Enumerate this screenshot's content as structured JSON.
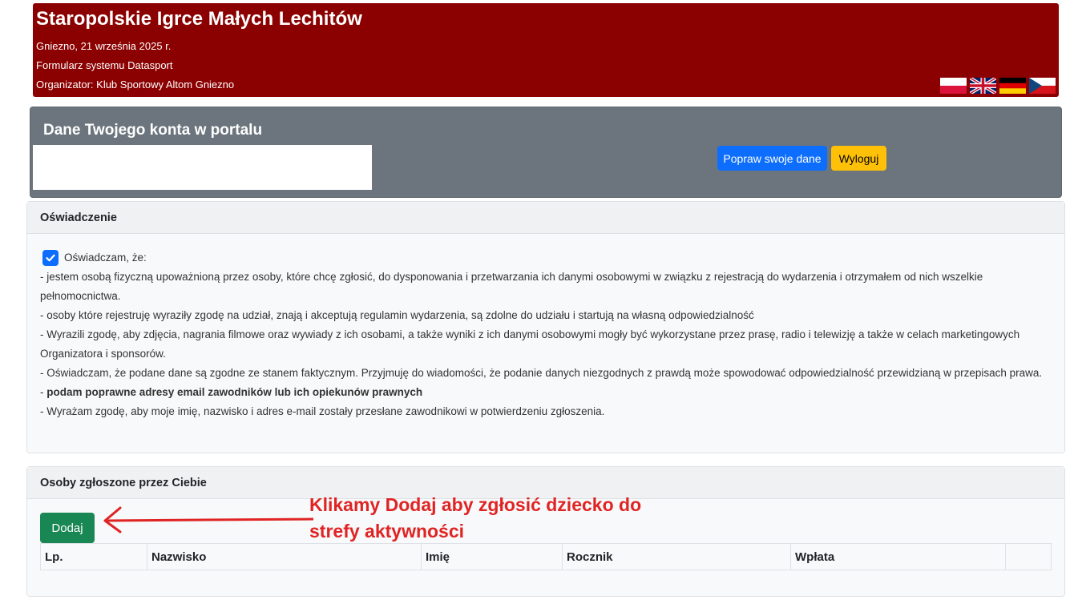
{
  "header": {
    "title": "Staropolskie Igrce Małych Lechitów",
    "date": "Gniezno, 21 września 2025 r.",
    "system": "Formularz systemu Datasport",
    "organizer": "Organizator: Klub Sportowy Altom Gniezno",
    "flags": [
      "flag-pl-icon",
      "flag-uk-icon",
      "flag-de-icon",
      "flag-cz-icon"
    ]
  },
  "account": {
    "title": "Dane Twojego konta w portalu",
    "edit_button": "Popraw swoje dane",
    "logout_button": "Wyloguj"
  },
  "declaration": {
    "header": "Oświadczenie",
    "checked": true,
    "intro": "Oświadczam, że:",
    "line1": "- jestem osobą fizyczną upoważnioną przez osoby, które chcę zgłosić, do dysponowania i przetwarzania ich danymi osobowymi w związku z rejestracją do wydarzenia i otrzymałem od nich wszelkie pełnomocnictwa.",
    "line2": "- osoby które rejestruję wyraziły zgodę na udział, znają i akceptują regulamin wydarzenia, są zdolne do udziału i startują na własną odpowiedzialność",
    "line3": "- Wyrazili zgodę, aby zdjęcia, nagrania filmowe oraz wywiady z ich osobami, a także wyniki z ich danymi osobowymi mogły być wykorzystane przez prasę, radio i telewizję a także w celach marketingowych Organizatora i sponsorów.",
    "line4": "- Oświadczam, że podane dane są zgodne ze stanem faktycznym. Przyjmuję do wiadomości, że podanie danych niezgodnych z prawdą może spowodować odpowiedzialność przewidzianą w przepisach prawa.",
    "line5_prefix": "- ",
    "line5_bold": "podam poprawne adresy email zawodników lub ich opiekunów prawnych",
    "line6": "- Wyrażam zgodę, aby moje imię, nazwisko i adres e-mail zostały przesłane zawodnikowi w potwierdzeniu zgłoszenia."
  },
  "persons": {
    "header": "Osoby zgłoszone przez Ciebie",
    "add_button": "Dodaj",
    "columns": [
      "Lp.",
      "Nazwisko",
      "Imię",
      "Rocznik",
      "Wpłata",
      ""
    ]
  },
  "annotation": {
    "text": "Klikamy Dodaj aby zgłosić dziecko do strefy aktywności",
    "color": "#e02424"
  },
  "colors": {
    "header_bg": "#8b0000",
    "account_bg": "#6c757d",
    "primary": "#0d6efd",
    "warning": "#ffc107",
    "success": "#198754"
  }
}
